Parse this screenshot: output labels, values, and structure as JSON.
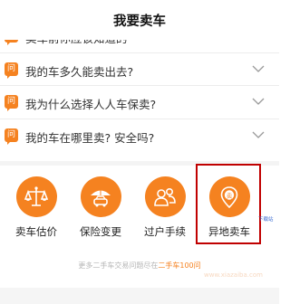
{
  "header": {
    "title": "我要卖车"
  },
  "faq": [
    {
      "text": "卖车前你应该知道的"
    },
    {
      "text": "我的车多久能卖出去?"
    },
    {
      "text": "我为什么选择人人车保卖?"
    },
    {
      "text": "我的车在哪里卖? 安全吗?"
    }
  ],
  "question_icon_text": "问",
  "services": [
    {
      "label": "卖车估价",
      "icon": "scale-icon"
    },
    {
      "label": "保险变更",
      "icon": "car-umbrella-icon"
    },
    {
      "label": "过户手续",
      "icon": "people-icon"
    },
    {
      "label": "异地卖车",
      "icon": "location-pin-icon",
      "pin_text": "卖"
    }
  ],
  "badge_text": "下载站",
  "footer": {
    "prefix": "更多二手车交易问题尽在",
    "highlight": "二手车100问"
  },
  "watermark": "www.xiazaiba.com",
  "colors": {
    "accent": "#f58220",
    "highlight_box": "#c00000"
  }
}
